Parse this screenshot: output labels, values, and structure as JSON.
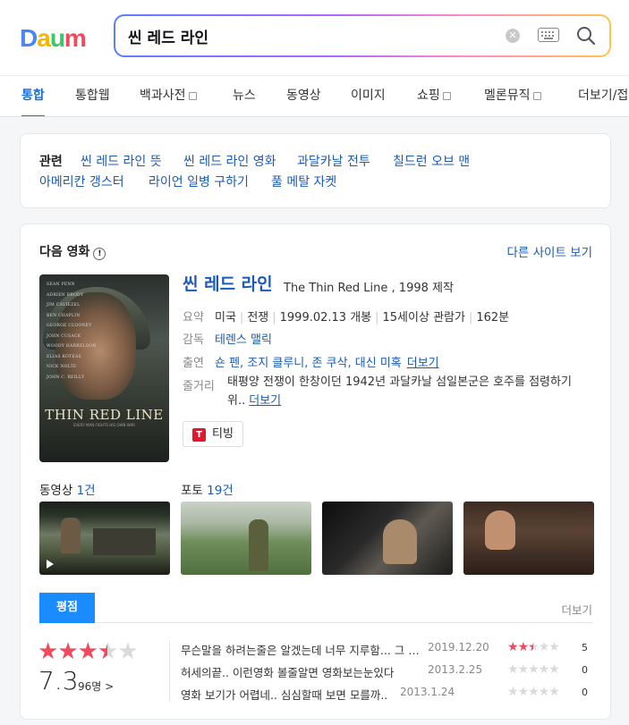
{
  "header": {
    "logo": "Daum",
    "search_value": "씬 레드 라인",
    "colors": {
      "logo_d": "#4b86f5",
      "logo_a": "#f8b500",
      "logo_u": "#3bc76a",
      "logo_m": "#f24a5d",
      "accent": "#1a6fd6"
    }
  },
  "tabs": [
    {
      "label": "통합",
      "active": true
    },
    {
      "label": "통합웹"
    },
    {
      "label": "백과사전",
      "external": true
    },
    {
      "label": "뉴스"
    },
    {
      "label": "동영상"
    },
    {
      "label": "이미지"
    },
    {
      "label": "쇼핑",
      "external": true
    },
    {
      "label": "멜론뮤직",
      "external": true
    },
    {
      "label": "더보기/접"
    }
  ],
  "related": {
    "label": "관련",
    "links": [
      "씬 레드 라인 뜻",
      "씬 레드 라인 영화",
      "과달카날 전투",
      "칠드런 오브 맨",
      "아메리칸 갱스터",
      "라이언 일병 구하기",
      "풀 메탈 자켓"
    ]
  },
  "movie_section": {
    "title": "다음 영화",
    "info_icon": "!",
    "other_site": "다른 사이트 보기",
    "poster": {
      "cast": [
        "SEAN PENN",
        "ADRIEN BRODY",
        "JIM CAVIEZEL",
        "BEN CHAPLIN",
        "GEORGE CLOONEY",
        "JOHN CUSACK",
        "WOODY HARRELSON",
        "ELIAS KOTEAS",
        "NICK NOLTE",
        "JOHN C. REILLY"
      ],
      "title": "THIN RED LINE",
      "tagline": "EVERY MAN FIGHTS HIS OWN WAR"
    },
    "movie_title": "씬 레드 라인",
    "movie_subtitle": "The Thin Red Line , 1998 제작",
    "summary_label": "요약",
    "summary": [
      "미국",
      "전쟁",
      "1999.02.13 개봉",
      "15세이상 관람가",
      "162분"
    ],
    "director_label": "감독",
    "director": "테렌스 맬릭",
    "cast_label": "출연",
    "cast": "숀 펜, 조지 클루니, 존 쿠삭, 대신 미혹",
    "cast_more": "더보기",
    "synopsis_label": "줄거리",
    "synopsis": "태평양 전쟁이 한창이던 1942년 과달카날 섬일본군은 호주를 점령하기 위..",
    "synopsis_more": "더보기",
    "tving_label": "티빙",
    "video_label": "동영상",
    "video_count": "1건",
    "photo_label": "포토",
    "photo_count": "19건",
    "rating_tab": "평점",
    "rating_more": "더보기",
    "rating_score": "7.3",
    "rating_stars": 3.5,
    "rating_voters": "96명",
    "rating_voters_arrow": ">",
    "reviews": [
      {
        "text": "무슨말을 하려는줄은 알겠는데 너무 지루함... 그 전쟁에서",
        "date": "2019.12.20",
        "stars": 2.5,
        "score": "5"
      },
      {
        "text": "허세의끝.. 이런영화 볼줄알면 영화보는눈있다",
        "date": "2013.2.25",
        "stars": 0,
        "score": "0"
      },
      {
        "text": "영화 보기가 어렵네.. 심심할때 보면 모를까..",
        "date": "2013.1.24",
        "stars": 0,
        "score": "0"
      }
    ]
  }
}
